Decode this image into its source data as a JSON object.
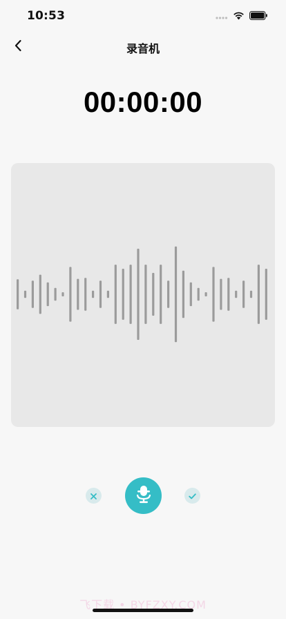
{
  "status_bar": {
    "time": "10:53",
    "icons": [
      "signal-dots-icon",
      "wifi-icon",
      "battery-icon"
    ]
  },
  "nav": {
    "title": "录音机",
    "back_icon": "chevron-left-icon"
  },
  "timer": {
    "value": "00:00:00"
  },
  "waveform": {
    "levels": [
      0.33,
      0.08,
      0.3,
      0.43,
      0.26,
      0.14,
      0.03,
      0.6,
      0.34,
      0.36,
      0.08,
      0.3,
      0.08,
      0.65,
      0.56,
      0.65,
      1.0,
      0.65,
      0.47,
      0.65,
      0.3,
      1.05,
      0.52,
      0.26,
      0.14,
      0.03,
      0.6,
      0.34,
      0.36,
      0.08,
      0.3,
      0.08,
      0.65,
      0.56
    ],
    "bar_color": "#9b9b9b",
    "panel_color": "#e8e8e8"
  },
  "controls": {
    "cancel_icon": "close-icon",
    "record_icon": "microphone-icon",
    "confirm_icon": "checkmark-icon",
    "accent_color": "#35bdc6"
  },
  "watermark": {
    "text": "飞下载 • BYFZXY.COM"
  }
}
